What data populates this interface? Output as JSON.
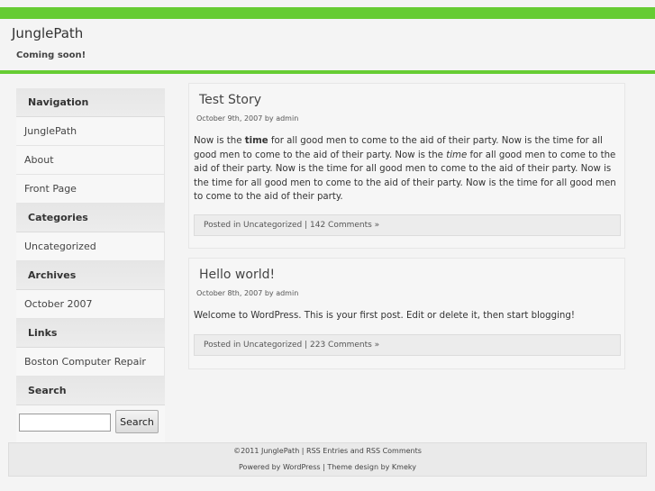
{
  "site": {
    "title": "JunglePath",
    "description": "Coming soon!"
  },
  "colors": {
    "accent": "#66cc33",
    "background": "#f4f4f4"
  },
  "sidebar": {
    "navigation_heading": "Navigation",
    "navigation_items": [
      "JunglePath",
      "About",
      "Front Page"
    ],
    "categories_heading": "Categories",
    "categories_items": [
      "Uncategorized"
    ],
    "archives_heading": "Archives",
    "archives_items": [
      "October 2007"
    ],
    "links_heading": "Links",
    "links_items": [
      "Boston Computer Repair"
    ],
    "search_heading": "Search",
    "search_button": "Search",
    "search_value": ""
  },
  "posts": [
    {
      "title": "Test Story",
      "meta": "October 9th, 2007 by admin",
      "body_1": "Now is the ",
      "body_bold": "time",
      "body_2": " for all good men to come to the aid of their party. Now is the time for all good men to come to the aid of their party. Now is the ",
      "body_italic": "time",
      "body_3": " for all good men to come to the aid of their party. Now is the time for all good men to come to the aid of their party. Now is the time for all good men to come to the aid of their party. Now is the time for all good men to come to the aid of their party.",
      "posted_in": "Posted in ",
      "category": "Uncategorized",
      "separator": " | ",
      "comments": "142 Comments »"
    },
    {
      "title": "Hello world!",
      "meta": "October 8th, 2007 by admin",
      "body": "Welcome to WordPress. This is your first post. Edit or delete it, then start blogging!",
      "posted_in": "Posted in ",
      "category": "Uncategorized",
      "separator": " | ",
      "comments": "223 Comments »"
    }
  ],
  "footer": {
    "copyright": "©2011 JunglePath | ",
    "rss_entries": "RSS Entries",
    "and": " and ",
    "rss_comments": "RSS Comments",
    "powered_by": "Powered by ",
    "wordpress": "WordPress",
    "theme_design_by": " | Theme design by ",
    "designer": "Kmeky"
  }
}
